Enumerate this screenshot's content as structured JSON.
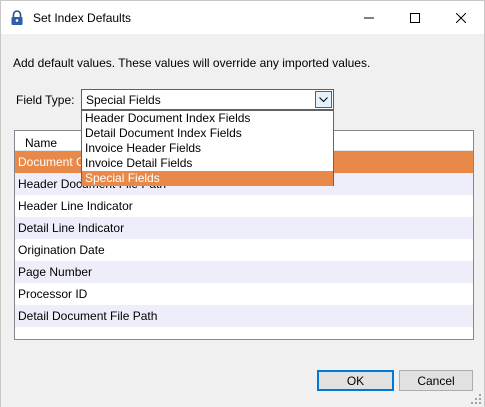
{
  "window": {
    "title": "Set Index Defaults",
    "icon": "padlock-icon",
    "controls": [
      "minimize-icon",
      "maximize-icon",
      "close-icon"
    ]
  },
  "description": "Add default values. These values will override any imported values.",
  "field_type": {
    "label": "Field Type:",
    "value": "Special Fields",
    "options": [
      "Header Document Index Fields",
      "Detail Document Index Fields",
      "Invoice Header Fields",
      "Invoice Detail Fields",
      "Special Fields"
    ],
    "selected_index": 4
  },
  "grid": {
    "columns": [
      "Name"
    ],
    "rows": [
      "Document Class",
      "Header Document File Path",
      "Header Line Indicator",
      "Detail Line Indicator",
      "Origination Date",
      "Page Number",
      "Processor ID",
      "Detail Document File Path"
    ],
    "selected_index": 0
  },
  "buttons": {
    "ok": "OK",
    "cancel": "Cancel"
  },
  "colors": {
    "selection": "#e8894a",
    "alt_row": "#eeeefa",
    "focus_border": "#0078d7"
  }
}
